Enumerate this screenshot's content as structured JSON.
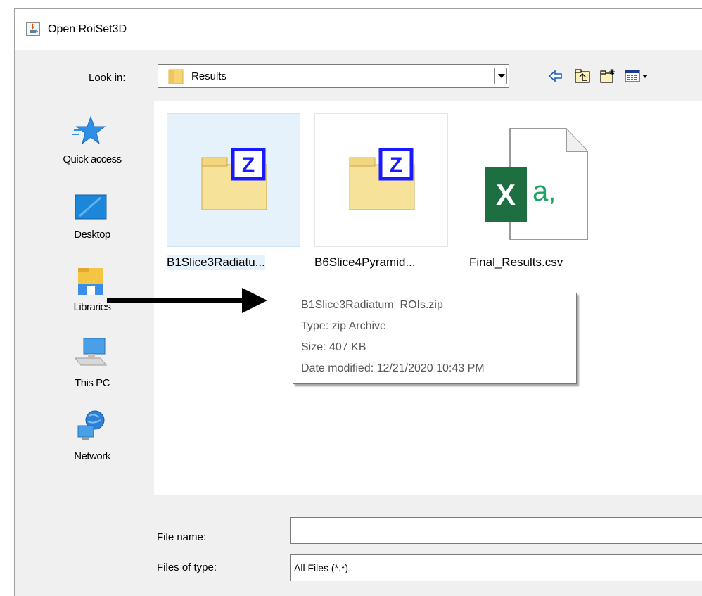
{
  "window": {
    "title": "Open RoiSet3D"
  },
  "lookin": {
    "label": "Look in:",
    "value": "Results"
  },
  "toolbar": {
    "back_icon": "back-arrow-icon",
    "up_icon": "up-folder-icon",
    "newfolder_icon": "new-folder-icon",
    "view_icon": "view-menu-icon"
  },
  "places": [
    {
      "label": "Quick access",
      "icon": "star-icon"
    },
    {
      "label": "Desktop",
      "icon": "desktop-icon"
    },
    {
      "label": "Libraries",
      "icon": "libraries-icon"
    },
    {
      "label": "This PC",
      "icon": "computer-icon"
    },
    {
      "label": "Network",
      "icon": "network-icon"
    }
  ],
  "files": [
    {
      "label": "B1Slice3Radiatu...",
      "icon": "zip-folder-icon",
      "selected": true
    },
    {
      "label": "B6Slice4Pyramid...",
      "icon": "zip-folder-icon",
      "selected": false
    },
    {
      "label": "Final_Results.csv",
      "icon": "excel-csv-icon",
      "selected": false
    }
  ],
  "tooltip": {
    "name": "B1Slice3Radiatum_ROIs.zip",
    "type": "Type: zip Archive",
    "size": "Size: 407 KB",
    "date": "Date modified: 12/21/2020 10:43 PM"
  },
  "filename": {
    "label": "File name:",
    "value": ""
  },
  "filetype": {
    "label": "Files of type:",
    "value": "All Files (*.*)"
  },
  "colors": {
    "selection": "#e5f1fb",
    "excel_green": "#1d6f42",
    "zip_blue": "#1a1aff"
  }
}
